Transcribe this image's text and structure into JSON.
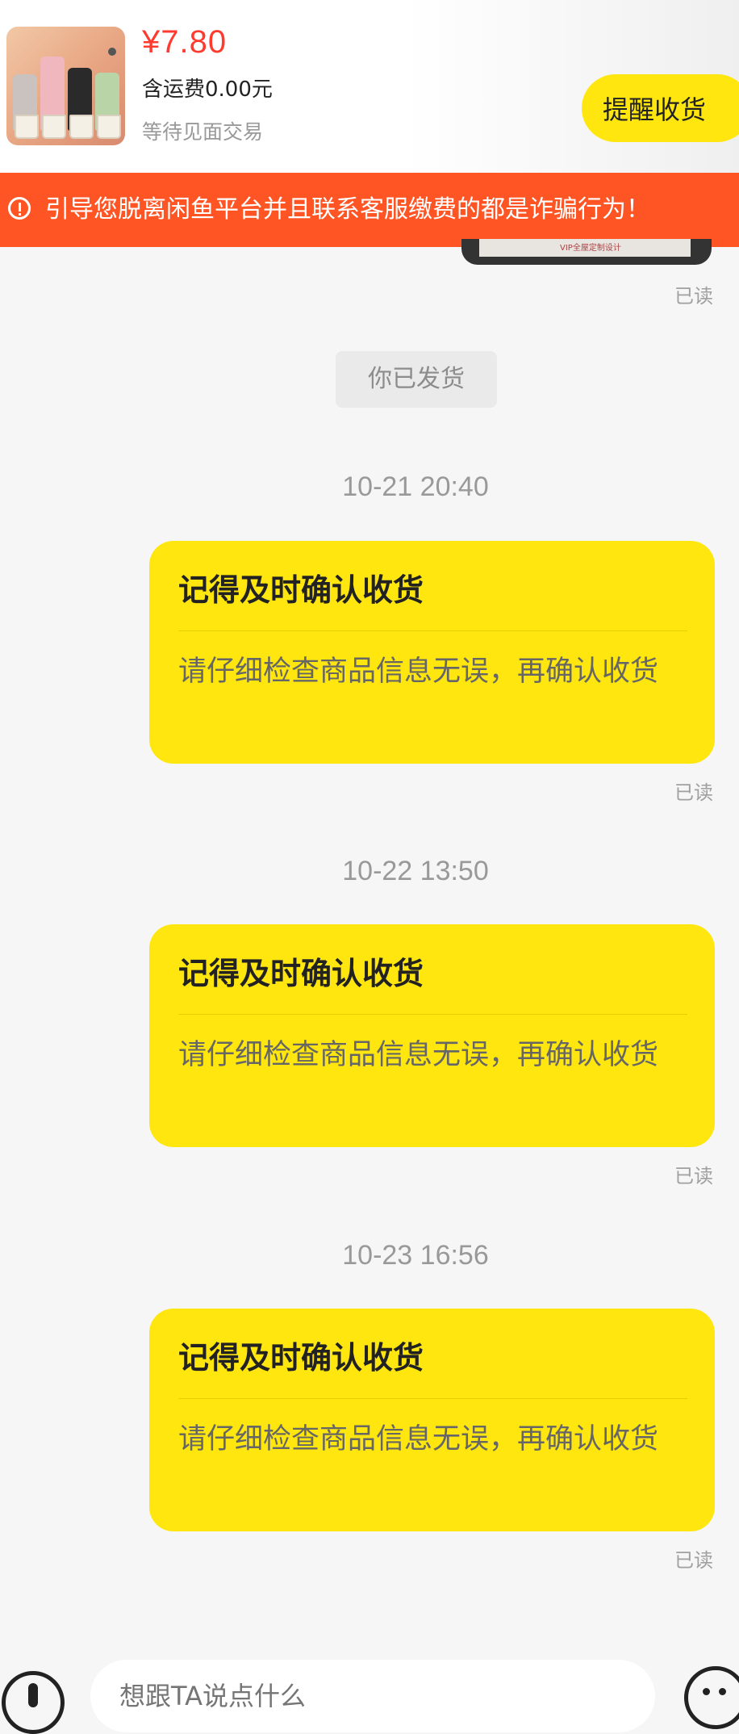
{
  "order": {
    "price": "¥7.80",
    "shipping": "含运费0.00元",
    "status": "等待见面交易",
    "remind_label": "提醒收货"
  },
  "warning": {
    "text": "引导您脱离闲鱼平台并且联系客服缴费的都是诈骗行为！"
  },
  "prev_image_text": "VIP全屋定制设计",
  "read_label": "已读",
  "system_message": "你已发货",
  "messages": [
    {
      "time": "10-21 20:40",
      "title": "记得及时确认收货",
      "body": "请仔细检查商品信息无误，再确认收货"
    },
    {
      "time": "10-22 13:50",
      "title": "记得及时确认收货",
      "body": "请仔细检查商品信息无误，再确认收货"
    },
    {
      "time": "10-23 16:56",
      "title": "记得及时确认收货",
      "body": "请仔细检查商品信息无误，再确认收货"
    }
  ],
  "input": {
    "placeholder": "想跟TA说点什么"
  },
  "colors": {
    "accent_yellow": "#ffe60f",
    "warning_orange": "#ff5524",
    "price_red": "#ff3b30"
  }
}
